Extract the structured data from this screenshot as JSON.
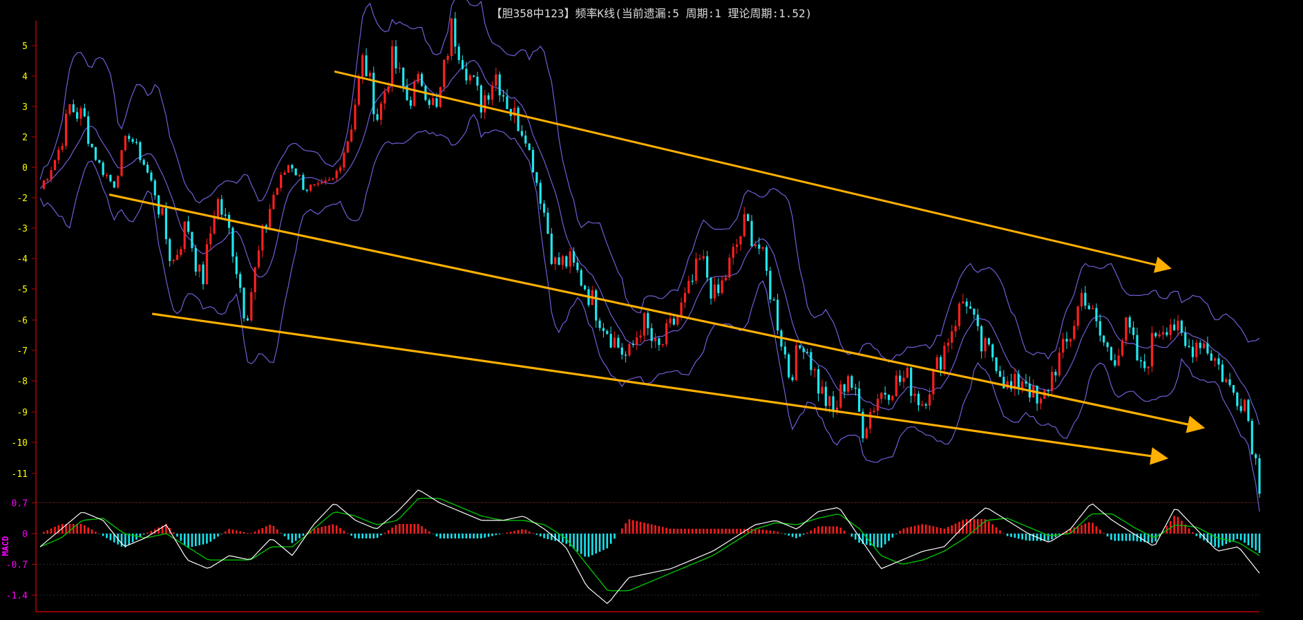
{
  "title": "【胆358中123】频率K线(当前遗漏:5 周期:1 理论周期:1.52)",
  "chart_data": [
    {
      "type": "candlestick",
      "panel": "main",
      "y_ticks": [
        5,
        4,
        3,
        2,
        0,
        -2,
        -3,
        -4,
        -5,
        -6,
        -7,
        -8,
        -9,
        -10,
        -11
      ],
      "y_tick_labels": [
        "5",
        "4",
        "3",
        "2",
        "0",
        "-2",
        "-3",
        "-4",
        "-5",
        "-6",
        "-7",
        "-8",
        "-9",
        "-10",
        "-11"
      ],
      "tick_color": "#ffff00",
      "up_color": "#ff2020",
      "down_color": "#20e8f0",
      "band_color": "#6f5fd8",
      "close_path": [
        -1.4,
        0.5,
        3.0,
        2.6,
        0.2,
        -1.2,
        2.3,
        0.4,
        -2.1,
        -4.2,
        -2.8,
        -4.9,
        -2.0,
        -3.3,
        -5.9,
        -3.6,
        -1.6,
        0.4,
        -1.3,
        -1.5,
        -0.8,
        2.0,
        4.6,
        2.6,
        4.6,
        3.2,
        3.9,
        2.8,
        5.6,
        4.3,
        3.1,
        4.1,
        2.9,
        2.2,
        -1.7,
        -4.2,
        -4.1,
        -4.8,
        -5.8,
        -6.6,
        -7.3,
        -6.0,
        -7.1,
        -6.2,
        -5.3,
        -4.0,
        -5.4,
        -4.1,
        -2.8,
        -3.7,
        -5.6,
        -7.8,
        -6.6,
        -8.2,
        -9.1,
        -7.7,
        -9.5,
        -8.5,
        -8.1,
        -7.9,
        -8.7,
        -7.6,
        -6.3,
        -5.2,
        -6.9,
        -7.2,
        -8.4,
        -7.8,
        -9.0,
        -7.6,
        -6.7,
        -5.0,
        -6.4,
        -7.3,
        -6.2,
        -7.8,
        -6.3,
        -6.0,
        -7.0,
        -6.6,
        -7.3,
        -8.3,
        -8.6,
        -11.3
      ],
      "annotations": [
        {
          "type": "arrow",
          "label": "",
          "from": [
            0.244,
            4.15
          ],
          "to": [
            0.925,
            -4.3
          ],
          "color": "#ffb000"
        },
        {
          "type": "arrow",
          "label": "",
          "from": [
            0.06,
            -1.8
          ],
          "to": [
            0.952,
            -9.5
          ],
          "color": "#ffb000"
        },
        {
          "type": "arrow",
          "label": "",
          "from": [
            0.095,
            -5.8
          ],
          "to": [
            0.922,
            -10.5
          ],
          "color": "#ffb000"
        }
      ]
    },
    {
      "type": "macd",
      "panel": "lower",
      "y_ticks": [
        0.7,
        0,
        -0.7,
        -1.4
      ],
      "y_tick_labels": [
        "0.7",
        "0",
        "-0.7",
        "-1.4"
      ],
      "tick_color": "#ff00ff",
      "vertical_label": "MACD",
      "dif_color": "#ffffff",
      "dea_color": "#00c000",
      "dif_path": [
        -0.3,
        0.1,
        0.5,
        0.3,
        -0.3,
        -0.1,
        0.2,
        -0.6,
        -0.8,
        -0.5,
        -0.6,
        -0.1,
        -0.5,
        0.2,
        0.7,
        0.3,
        0.1,
        0.5,
        1.0,
        0.7,
        0.5,
        0.3,
        0.3,
        0.4,
        0.1,
        -0.3,
        -1.2,
        -1.6,
        -1.0,
        -0.9,
        -0.8,
        -0.6,
        -0.4,
        -0.1,
        0.2,
        0.3,
        0.1,
        0.5,
        0.6,
        -0.1,
        -0.8,
        -0.6,
        -0.4,
        -0.3,
        0.2,
        0.6,
        0.3,
        0.0,
        -0.2,
        0.1,
        0.7,
        0.3,
        0.0,
        -0.3,
        0.6,
        0.1,
        -0.4,
        -0.3,
        -0.9
      ],
      "dea_path": [
        -0.3,
        -0.1,
        0.3,
        0.35,
        0.0,
        -0.1,
        0.0,
        -0.3,
        -0.6,
        -0.6,
        -0.6,
        -0.3,
        -0.3,
        0.1,
        0.5,
        0.4,
        0.2,
        0.3,
        0.8,
        0.8,
        0.6,
        0.4,
        0.3,
        0.3,
        0.2,
        -0.1,
        -0.7,
        -1.3,
        -1.3,
        -1.1,
        -0.9,
        -0.7,
        -0.5,
        -0.2,
        0.1,
        0.25,
        0.2,
        0.35,
        0.45,
        0.1,
        -0.5,
        -0.7,
        -0.6,
        -0.4,
        -0.1,
        0.3,
        0.35,
        0.15,
        -0.05,
        0.0,
        0.45,
        0.45,
        0.15,
        -0.1,
        0.2,
        0.15,
        -0.1,
        -0.2,
        -0.5
      ]
    }
  ],
  "colors": {
    "background": "#000000",
    "axis": "#c00000",
    "title": "#dcdcdc"
  }
}
